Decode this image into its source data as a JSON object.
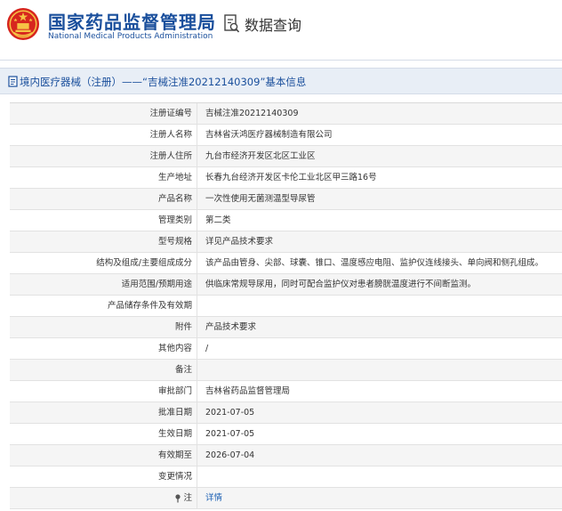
{
  "header": {
    "org_cn": "国家药品监督管理局",
    "org_en": "National Medical Products Administration",
    "query_label": "数据查询"
  },
  "titlebar": {
    "text": "境内医疗器械（注册）——“吉械注准20212140309”基本信息"
  },
  "rows": [
    {
      "label": "注册证编号",
      "value": "吉械注准20212140309"
    },
    {
      "label": "注册人名称",
      "value": "吉林省沃鸿医疗器械制造有限公司"
    },
    {
      "label": "注册人住所",
      "value": "九台市经济开发区北区工业区"
    },
    {
      "label": "生产地址",
      "value": "长春九台经济开发区卡伦工业北区甲三路16号"
    },
    {
      "label": "产品名称",
      "value": "一次性使用无菌测温型导尿管"
    },
    {
      "label": "管理类别",
      "value": "第二类"
    },
    {
      "label": "型号规格",
      "value": "详见产品技术要求"
    },
    {
      "label": "结构及组成/主要组成成分",
      "value": "该产品由管身、尖部、球囊、锥口、温度感应电阻、监护仪连线接头、单向阀和侧孔组成。"
    },
    {
      "label": "适用范围/预期用途",
      "value": "供临床常规导尿用，同时可配合监护仪对患者膀胱温度进行不间断监测。"
    },
    {
      "label": "产品储存条件及有效期",
      "value": ""
    },
    {
      "label": "附件",
      "value": "产品技术要求"
    },
    {
      "label": "其他内容",
      "value": "/"
    },
    {
      "label": "备注",
      "value": ""
    },
    {
      "label": "审批部门",
      "value": "吉林省药品监督管理局"
    },
    {
      "label": "批准日期",
      "value": "2021-07-05"
    },
    {
      "label": "生效日期",
      "value": "2021-07-05"
    },
    {
      "label": "有效期至",
      "value": "2026-07-04"
    },
    {
      "label": "变更情况",
      "value": ""
    },
    {
      "label": "注",
      "value": "详情"
    }
  ],
  "colors": {
    "brand_blue": "#1a4f9c",
    "emblem_red": "#d7261e",
    "emblem_gold": "#f6c445",
    "link_blue": "#1a5fb4"
  },
  "icons": {
    "emblem": "national-emblem-icon",
    "query": "data-query-icon",
    "title": "document-icon",
    "note": "pin-icon"
  }
}
